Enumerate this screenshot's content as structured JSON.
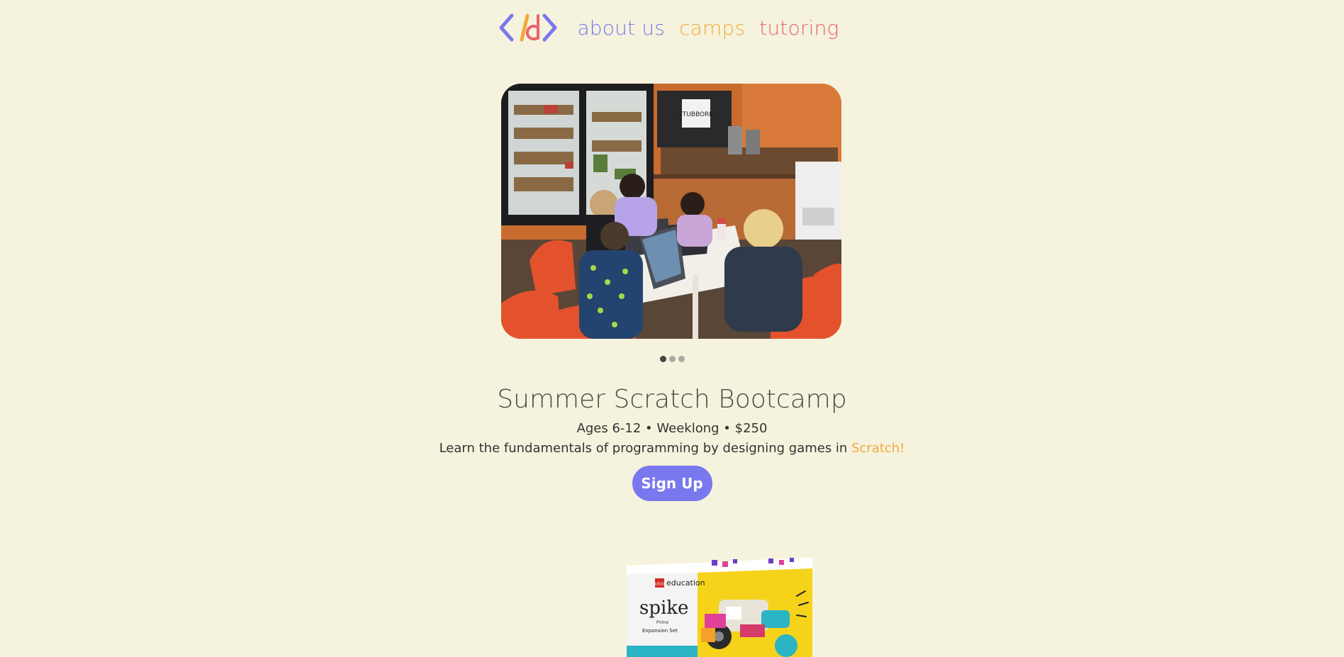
{
  "colors": {
    "background": "#f5f3dd",
    "purple": "#7a78ee",
    "orange": "#f3a93d",
    "pink": "#e8636d",
    "dot_active": "#444444",
    "dot_inactive": "#a9a9a2"
  },
  "logo": {
    "icon": "code-brackets-d-logo"
  },
  "nav": {
    "items": [
      {
        "label": "about us",
        "color": "#7a78ee"
      },
      {
        "label": "camps",
        "color": "#f3a93d"
      },
      {
        "label": "tutoring",
        "color": "#e8636d"
      }
    ]
  },
  "carousel": {
    "image": "kids-coding-cafe-photo",
    "slide_count": 3,
    "active_slide": 1
  },
  "camp": {
    "title": "Summer Scratch Bootcamp",
    "meta": "Ages 6-12 • Weeklong • $250",
    "description": "Learn the fundamentals of programming by designing games in ",
    "highlight": "Scratch!",
    "signup_label": "Sign Up"
  },
  "next_item": {
    "image": "lego-spike-prime-expansion-box",
    "brand_text": "education",
    "product_text": "spike",
    "sub_text": "Prime",
    "caption_text": "Expansion Set"
  }
}
